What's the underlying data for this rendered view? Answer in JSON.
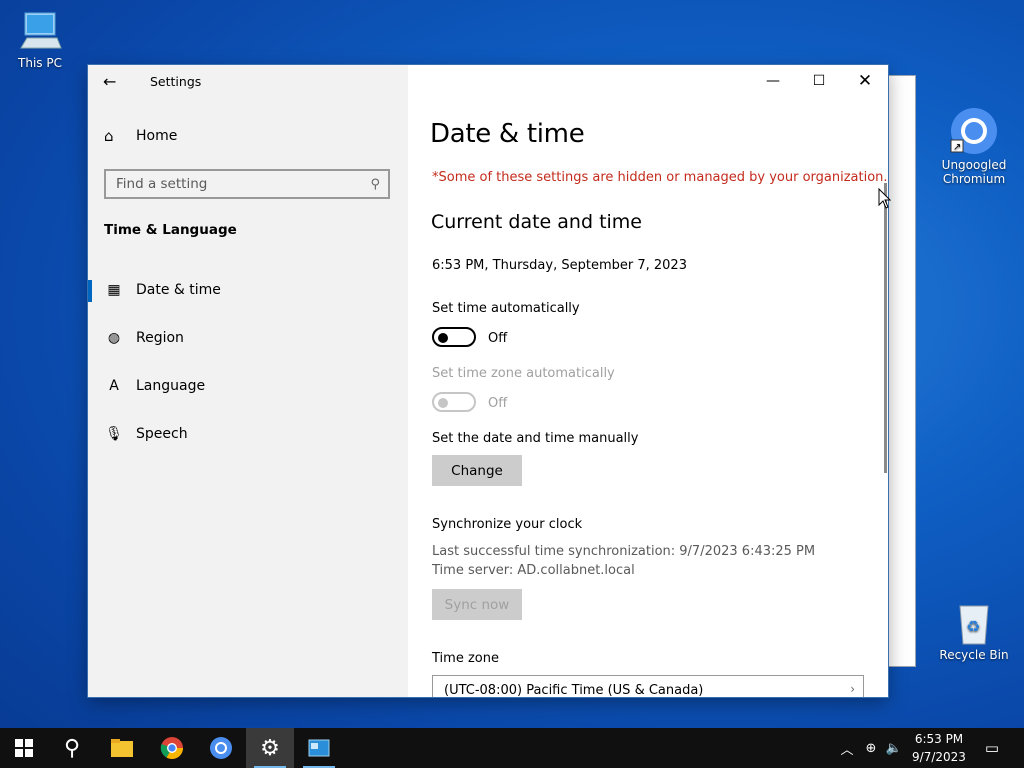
{
  "desktop": {
    "icons": [
      {
        "label": "This PC"
      },
      {
        "label": "Ungoogled Chromium"
      },
      {
        "label": "Recycle Bin"
      }
    ]
  },
  "window": {
    "title": "Settings",
    "controls": {
      "minimize": "minimize-icon",
      "maximize": "maximize-icon",
      "close": "close-icon"
    }
  },
  "sidebar": {
    "home_label": "Home",
    "search_placeholder": "Find a setting",
    "section_title": "Time & Language",
    "items": [
      {
        "label": "Date & time",
        "icon": "calendar-clock-icon",
        "selected": true
      },
      {
        "label": "Region",
        "icon": "globe-icon",
        "selected": false
      },
      {
        "label": "Language",
        "icon": "language-icon",
        "selected": false
      },
      {
        "label": "Speech",
        "icon": "microphone-icon",
        "selected": false
      }
    ]
  },
  "main": {
    "title": "Date & time",
    "warning": "*Some of these settings are hidden or managed by your organization.",
    "current_heading": "Current date and time",
    "current_value": "6:53 PM, Thursday, September 7, 2023",
    "set_time_auto": {
      "label": "Set time automatically",
      "state": "Off"
    },
    "set_zone_auto": {
      "label": "Set time zone automatically",
      "state": "Off",
      "disabled": true
    },
    "manual": {
      "label": "Set the date and time manually",
      "button": "Change"
    },
    "sync": {
      "heading": "Synchronize your clock",
      "last_sync": "Last successful time synchronization: 9/7/2023 6:43:25 PM",
      "server": "Time server: AD.collabnet.local",
      "button": "Sync now"
    },
    "timezone": {
      "label": "Time zone",
      "value": "(UTC-08:00) Pacific Time (US & Canada)"
    }
  },
  "taskbar": {
    "clock_time": "6:53 PM",
    "clock_date": "9/7/2023"
  },
  "colors": {
    "accent": "#0067c0",
    "warning": "#c42b1c",
    "desktop": "#0f5fc4"
  }
}
